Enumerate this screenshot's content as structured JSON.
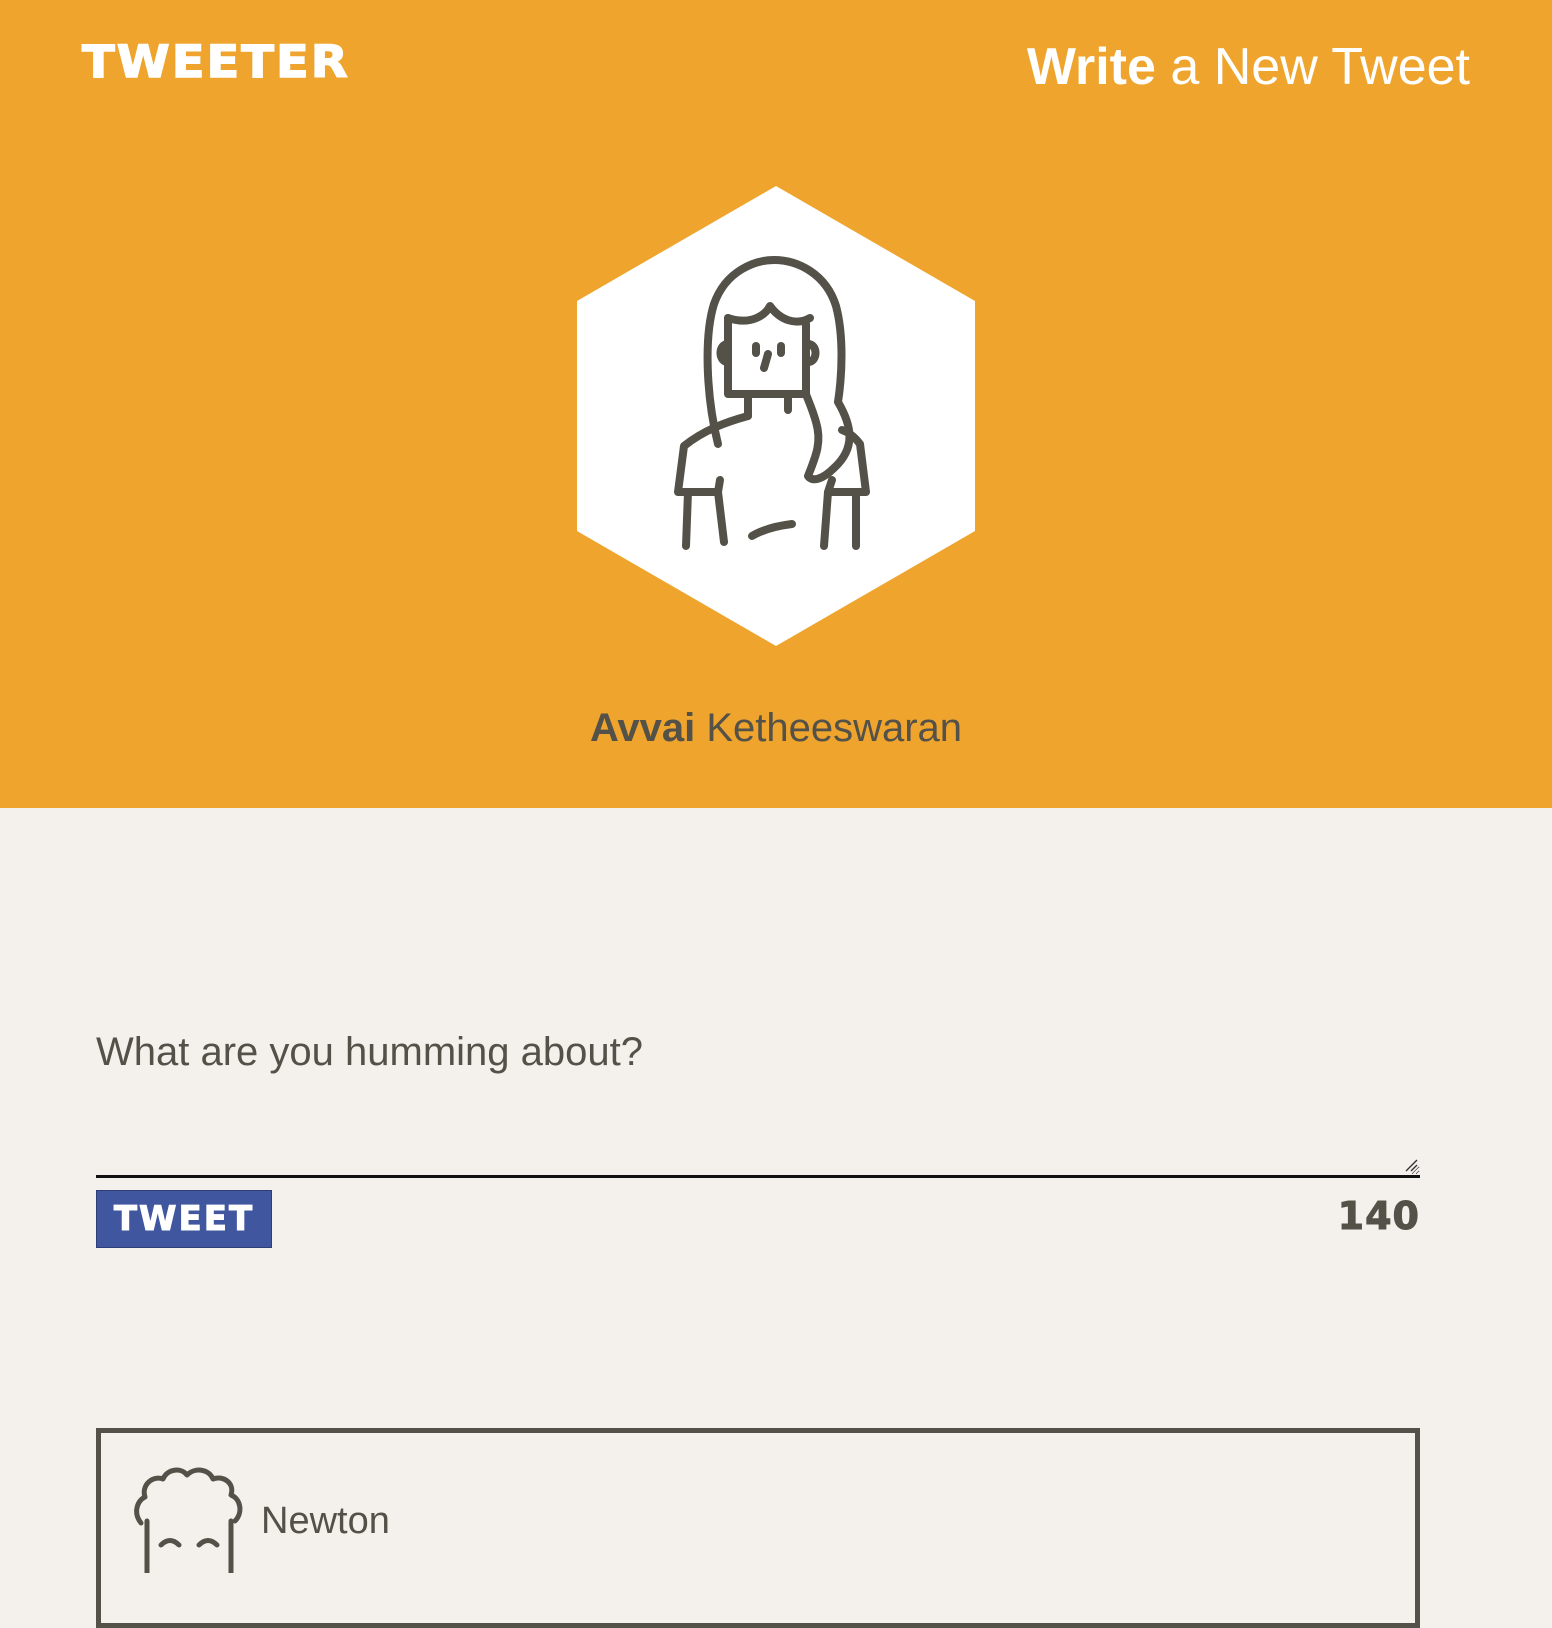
{
  "header": {
    "brand": "TWEETER",
    "compose_toggle": {
      "strong": "Write",
      "light": "a New Tweet"
    },
    "profile": {
      "first_name": "Avvai",
      "last_name": "Ketheeswaran",
      "avatar_icon": "woman-avatar-icon"
    }
  },
  "compose": {
    "placeholder": "What are you humming about?",
    "value": "",
    "button_label": "TWEET",
    "counter": "140"
  },
  "tweets": [
    {
      "name": "Newton",
      "avatar_icon": "curly-hair-avatar-icon"
    }
  ],
  "colors": {
    "header_bg": "#eea42d",
    "page_bg": "#f4f1ec",
    "text_dark": "#545149",
    "button_bg": "#4057a0"
  }
}
